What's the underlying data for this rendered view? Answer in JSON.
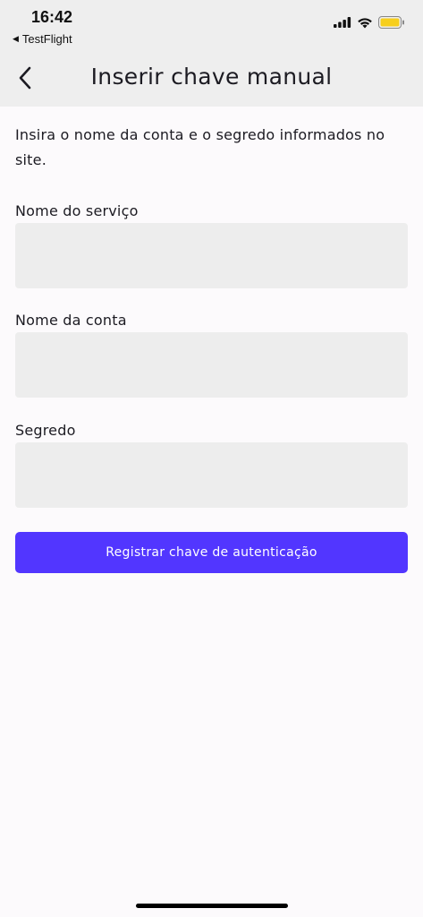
{
  "status_bar": {
    "time": "16:42",
    "back_app_label": "TestFlight",
    "icons": [
      "signal-icon",
      "wifi-icon",
      "battery-icon"
    ]
  },
  "header": {
    "title": "Inserir chave manual"
  },
  "intro_text": "Insira o nome da conta e o segredo informados no site.",
  "fields": [
    {
      "label": "Nome do serviço",
      "value": ""
    },
    {
      "label": "Nome da conta",
      "value": ""
    },
    {
      "label": "Segredo",
      "value": ""
    }
  ],
  "submit_label": "Registrar chave de autenticação",
  "colors": {
    "accent": "#5236ff",
    "header_bg": "#eeeeee",
    "input_bg": "#ededed",
    "page_bg": "#fcfafc",
    "battery": "#f7cf1d"
  }
}
